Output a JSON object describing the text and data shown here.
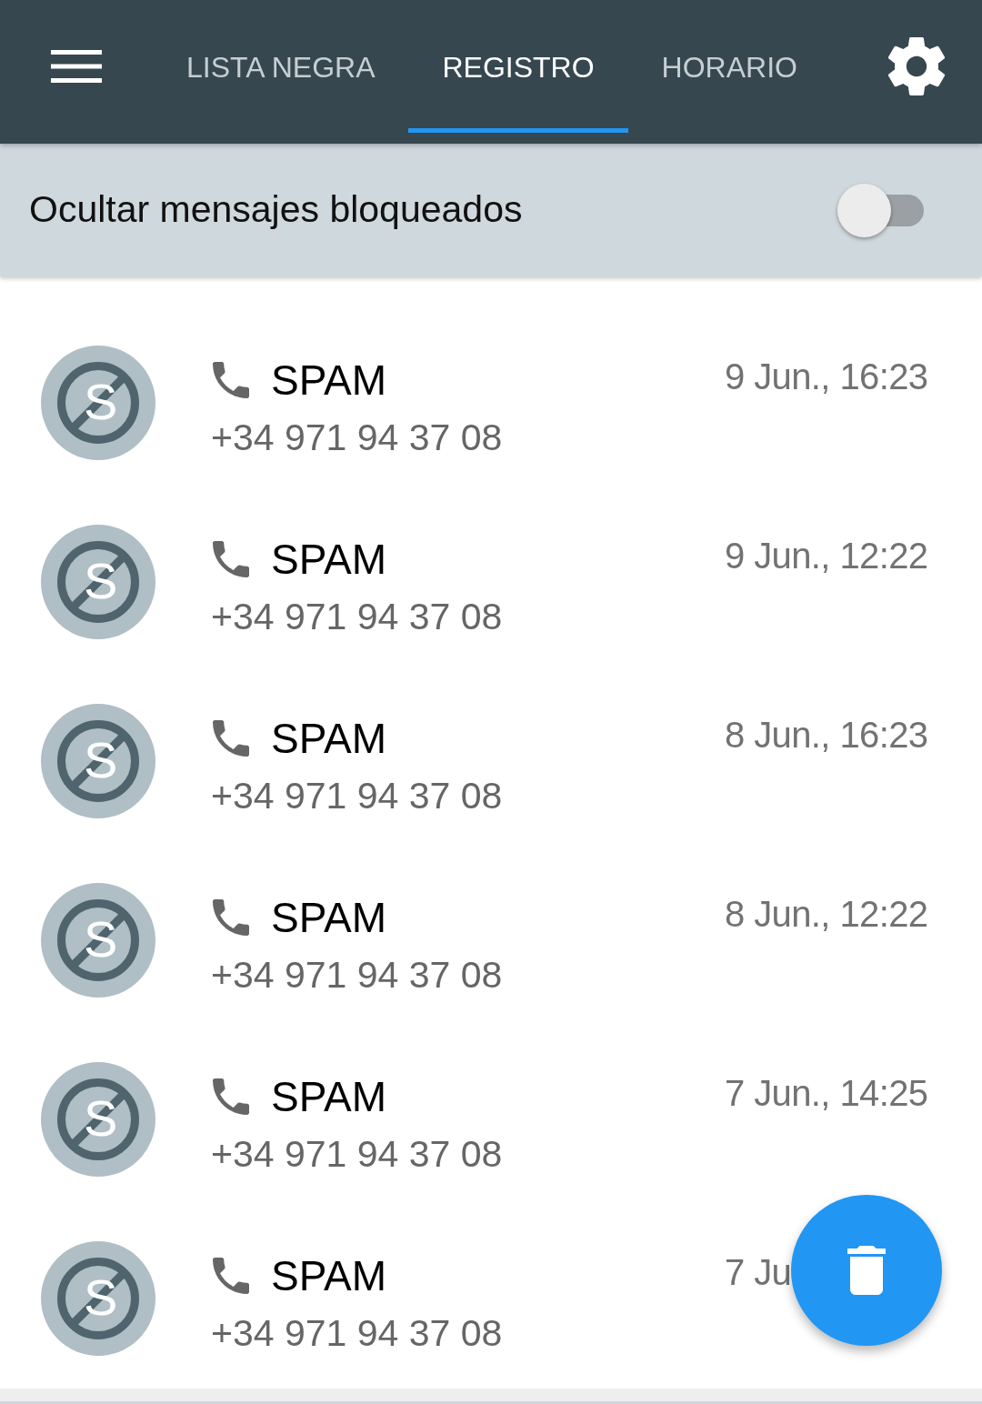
{
  "toolbar": {
    "tabs": [
      {
        "label": "LISTA NEGRA",
        "selected": false
      },
      {
        "label": "REGISTRO",
        "selected": true
      },
      {
        "label": "HORARIO",
        "selected": false
      }
    ]
  },
  "hide_blocked": {
    "label": "Ocultar mensajes bloqueados",
    "on": false
  },
  "log": [
    {
      "avatar_letter": "S",
      "title": "SPAM",
      "number": "+34 971 94 37 08",
      "date": "9 Jun., 16:23"
    },
    {
      "avatar_letter": "S",
      "title": "SPAM",
      "number": "+34 971 94 37 08",
      "date": "9 Jun., 12:22"
    },
    {
      "avatar_letter": "S",
      "title": "SPAM",
      "number": "+34 971 94 37 08",
      "date": "8 Jun., 16:23"
    },
    {
      "avatar_letter": "S",
      "title": "SPAM",
      "number": "+34 971 94 37 08",
      "date": "8 Jun., 12:22"
    },
    {
      "avatar_letter": "S",
      "title": "SPAM",
      "number": "+34 971 94 37 08",
      "date": "7 Jun., 14:25"
    },
    {
      "avatar_letter": "S",
      "title": "SPAM",
      "number": "+34 971 94 37 08",
      "date": "7 Ju"
    }
  ]
}
